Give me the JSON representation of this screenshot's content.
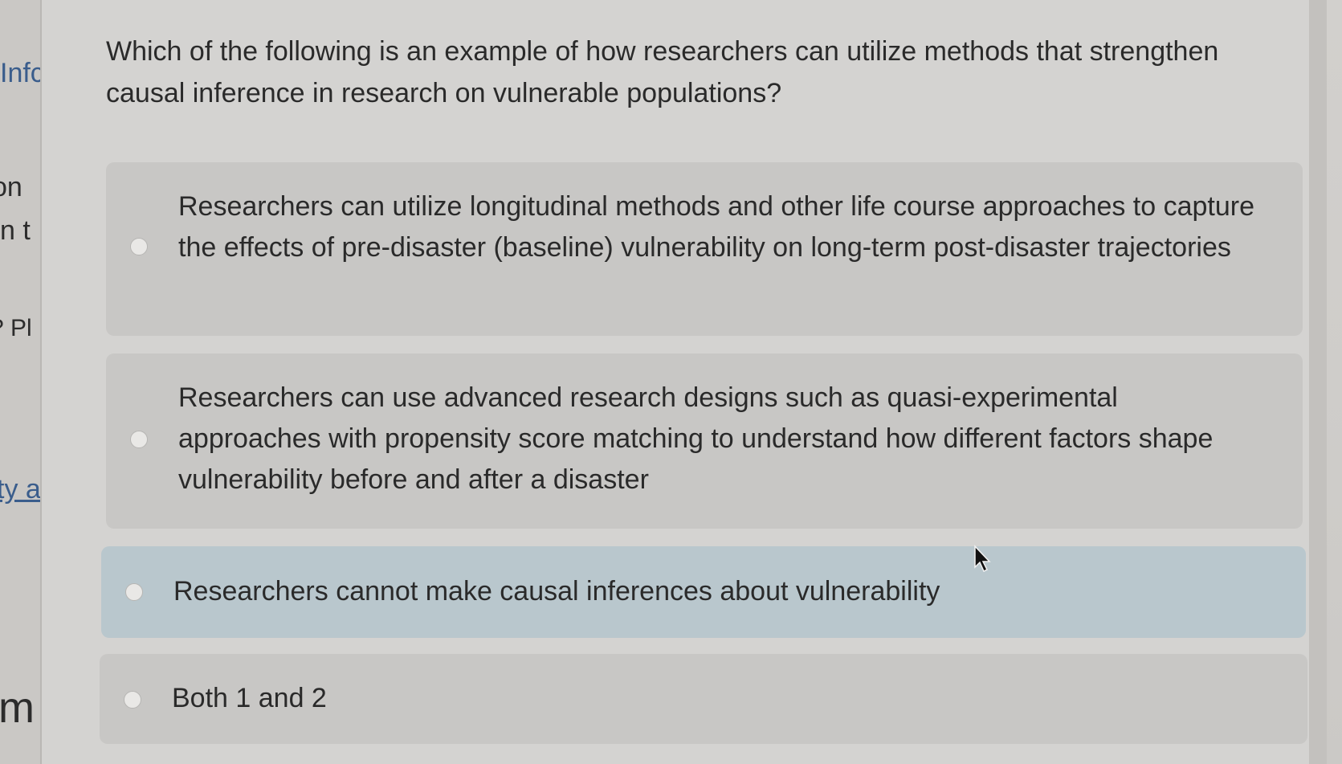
{
  "sidebar_fragments": {
    "f1": "Infc",
    "f2": "on",
    "f3": "n t",
    "f4": "? Pl",
    "f5": "ty a",
    "f6": "m"
  },
  "question": {
    "text": "Which of the following is an example of how researchers can utilize methods that strengthen causal inference in research on vulnerable populations?"
  },
  "options": [
    {
      "label": "Researchers can utilize longitudinal methods and other life course approaches to capture the effects of pre-disaster (baseline) vulnerability on long-term post-disaster trajectories",
      "selected": false,
      "hovered": false
    },
    {
      "label": "Researchers can use advanced research designs such as quasi-experimental approaches with propensity score matching to understand how different factors shape vulnerability before and after a disaster",
      "selected": false,
      "hovered": false
    },
    {
      "label": "Researchers cannot make causal inferences about vulnerability",
      "selected": false,
      "hovered": true
    },
    {
      "label": "Both 1 and 2",
      "selected": false,
      "hovered": false
    }
  ],
  "colors": {
    "option_background": "#c8c7c5",
    "option_hover_background": "#b9c7cd",
    "text": "#2a2a2a",
    "link_blue": "#3a5d8c"
  },
  "icons": {
    "cursor": "mouse-pointer-icon",
    "radio": "radio-button-icon"
  }
}
